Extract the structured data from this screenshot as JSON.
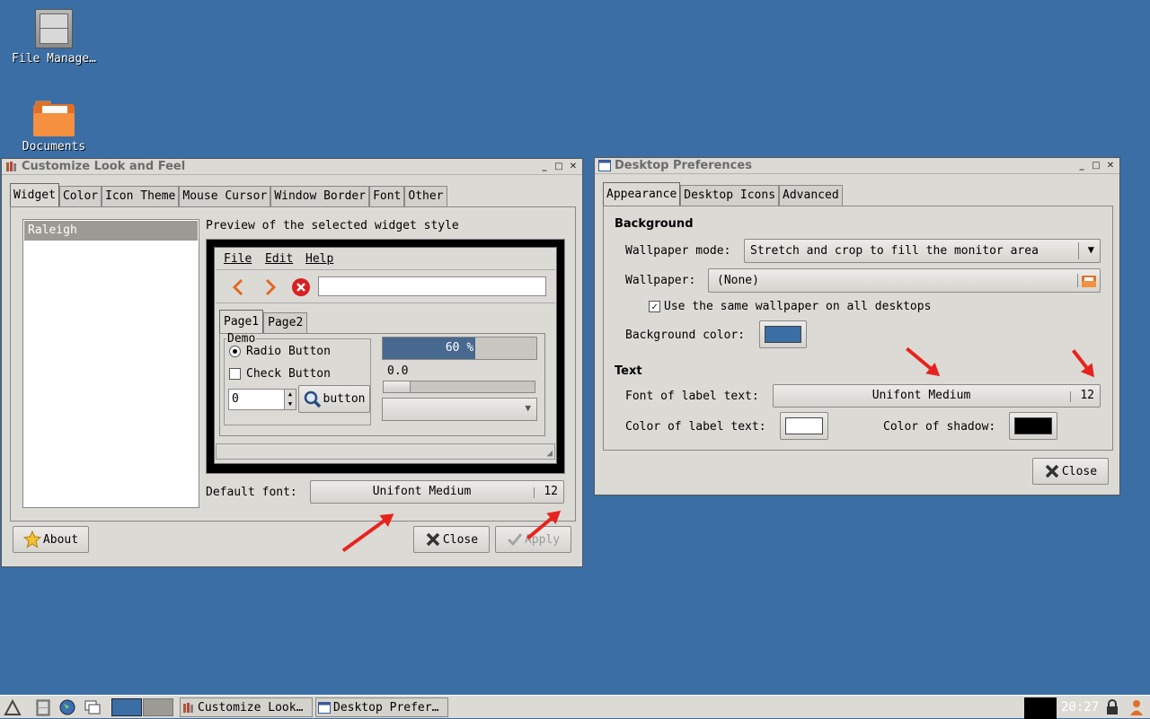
{
  "desktop": {
    "icons": [
      {
        "label": "File Manage…",
        "icon": "file-cabinet-icon"
      },
      {
        "label": "Documents",
        "icon": "folder-icon"
      }
    ]
  },
  "look_feel": {
    "title": "Customize Look and Feel",
    "tabs": [
      "Widget",
      "Color",
      "Icon Theme",
      "Mouse Cursor",
      "Window Border",
      "Font",
      "Other"
    ],
    "active_tab": "Widget",
    "themes": [
      "Raleigh"
    ],
    "selected_theme": "Raleigh",
    "preview_label": "Preview of the selected widget style",
    "preview": {
      "menu": [
        "File",
        "Edit",
        "Help"
      ],
      "tabs": [
        "Page1",
        "Page2"
      ],
      "demo_label": "Demo",
      "radio_label": "Radio Button",
      "check_label": "Check Button",
      "spin_value": "0",
      "button_label": "button",
      "progress_text": "60 %",
      "progress": 0.6,
      "scale_value": "0.0"
    },
    "default_font_label": "Default font:",
    "font_name": "Unifont Medium",
    "font_size": "12",
    "about_label": "About",
    "close_label": "Close",
    "apply_label": "Apply"
  },
  "desktop_prefs": {
    "title": "Desktop Preferences",
    "tabs": [
      "Appearance",
      "Desktop Icons",
      "Advanced"
    ],
    "active_tab": "Appearance",
    "background_heading": "Background",
    "wallpaper_mode_label": "Wallpaper mode:",
    "wallpaper_mode_value": "Stretch and crop to fill the monitor area",
    "wallpaper_label": "Wallpaper:",
    "wallpaper_value": "(None)",
    "same_wallpaper_label": "Use the same wallpaper on all desktops",
    "same_wallpaper_checked": true,
    "bg_color_label": "Background color:",
    "bg_color": "#3a6ea5",
    "text_heading": "Text",
    "font_label": "Font of label text:",
    "font_name": "Unifont Medium",
    "font_size": "12",
    "color_label": "Color of label text:",
    "label_color": "#ffffff",
    "shadow_label": "Color of shadow:",
    "shadow_color": "#000000",
    "close_label": "Close"
  },
  "taskbar": {
    "tasks": [
      "Customize Look…",
      "Desktop Prefer…"
    ],
    "clock": "20:27"
  },
  "colors": {
    "desktop": "#3a6ea5",
    "window": "#dcdad5",
    "annotation_arrow": "#e8231e"
  }
}
